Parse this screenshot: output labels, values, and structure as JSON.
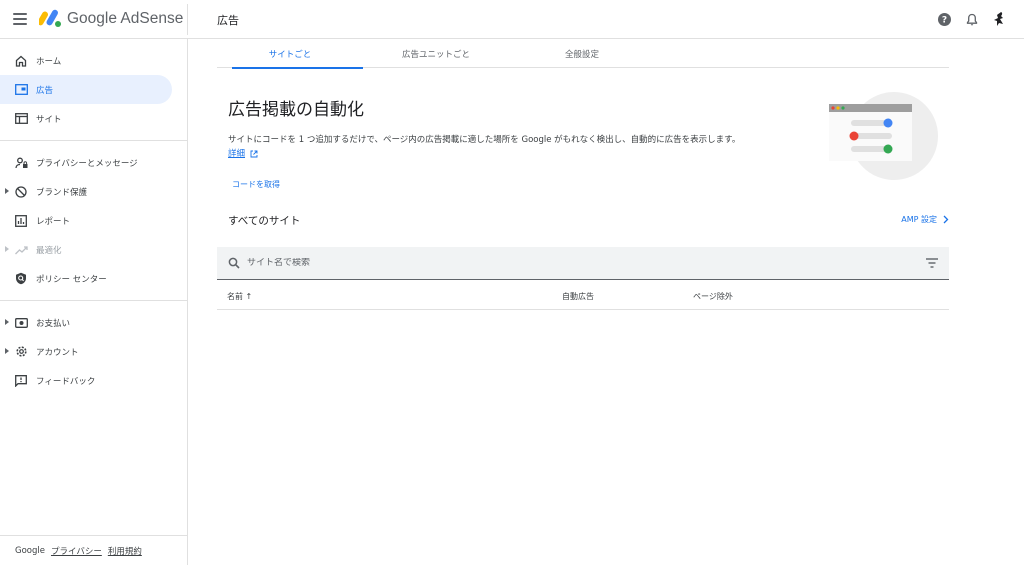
{
  "header": {
    "brand": "Google AdSense",
    "page_title": "広告"
  },
  "sidebar": {
    "groups": [
      [
        {
          "label": "ホーム",
          "icon": "home-icon",
          "active": false
        },
        {
          "label": "広告",
          "icon": "ads-icon",
          "active": true
        },
        {
          "label": "サイト",
          "icon": "sites-icon",
          "active": false
        }
      ],
      [
        {
          "label": "プライバシーとメッセージ",
          "icon": "privacy-icon"
        },
        {
          "label": "ブランド保護",
          "icon": "block-icon",
          "caret": true
        },
        {
          "label": "レポート",
          "icon": "reports-icon"
        },
        {
          "label": "最適化",
          "icon": "optimize-icon",
          "caret": true,
          "disabled": true
        },
        {
          "label": "ポリシー センター",
          "icon": "policy-icon"
        }
      ],
      [
        {
          "label": "お支払い",
          "icon": "payments-icon",
          "caret": true
        },
        {
          "label": "アカウント",
          "icon": "account-gear-icon",
          "caret": true
        },
        {
          "label": "フィードバック",
          "icon": "feedback-icon"
        }
      ]
    ],
    "footer": {
      "google": "Google",
      "privacy": "プライバシー",
      "terms": "利用規約"
    }
  },
  "main": {
    "tabs": [
      {
        "label": "サイトごと",
        "active": true
      },
      {
        "label": "広告ユニットごと",
        "active": false
      },
      {
        "label": "全般設定",
        "active": false
      }
    ],
    "hero": {
      "title": "広告掲載の自動化",
      "description": "サイトにコードを 1 つ追加するだけで、ページ内の広告掲載に適した場所を Google がもれなく検出し、自動的に広告を表示します。",
      "more_link": "詳細",
      "get_code": "コードを取得"
    },
    "sites_heading": "すべてのサイト",
    "amp_settings": "AMP 設定",
    "search": {
      "placeholder": "サイト名で検索"
    },
    "table": {
      "columns": [
        "名前 ↑",
        "自動広告",
        "ページ除外"
      ]
    }
  },
  "colors": {
    "accent": "#1a73e8",
    "active_bg": "#e8f0fe",
    "logo_yellow": "#fbbc04",
    "logo_blue": "#4285f4",
    "logo_green": "#34a853",
    "illus_red": "#ea4335"
  }
}
